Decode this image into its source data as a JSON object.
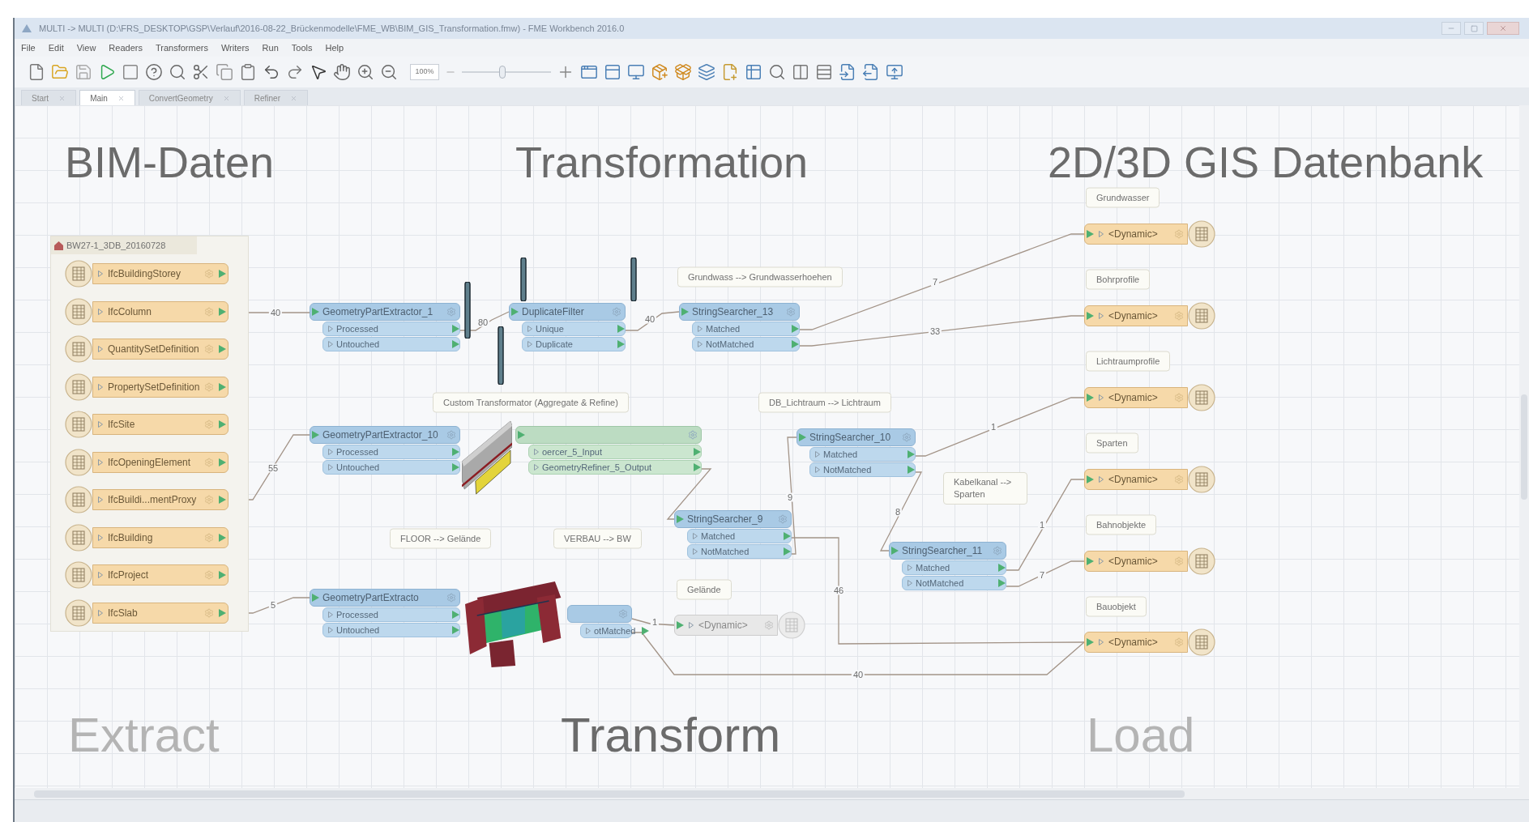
{
  "window": {
    "title": "MULTI -> MULTI (D:\\FRS_DESKTOP\\GSP\\Verlauf\\2016-08-22_Brückenmodelle\\FME_WB\\BIM_GIS_Transformation.fmw) - FME Workbench 2016.0"
  },
  "menu": [
    "File",
    "Edit",
    "View",
    "Readers",
    "Transformers",
    "Writers",
    "Run",
    "Tools",
    "Help"
  ],
  "toolbar": {
    "zoom": "100%",
    "zoom_slider": {
      "level": 0.45
    }
  },
  "tabs": [
    {
      "label": "Start",
      "selected": false
    },
    {
      "label": "Main",
      "selected": true
    },
    {
      "label": "ConvertGeometry",
      "selected": false
    },
    {
      "label": "Refiner",
      "selected": false
    }
  ],
  "canvas": {
    "headings": [
      {
        "text": "BIM-Daten",
        "kind": "strong"
      },
      {
        "text": "Transformation",
        "kind": "strong"
      },
      {
        "text": "2D/3D GIS Datenbank",
        "kind": "strong"
      }
    ],
    "phases": [
      {
        "text": "Extract",
        "kind": "faded"
      },
      {
        "text": "Transform",
        "kind": "strong"
      },
      {
        "text": "Load",
        "kind": "faded"
      }
    ],
    "reader": {
      "name": "BW27-1_3DB_20160728",
      "feature_types": [
        "IfcBuildingStorey",
        "IfcColumn",
        "QuantitySetDefinition",
        "PropertySetDefinition",
        "IfcSite",
        "IfcOpeningElement",
        "IfcBuildi...mentProxy",
        "IfcBuilding",
        "IfcProject",
        "IfcSlab"
      ]
    },
    "transformers": [
      {
        "kind": "standard",
        "name": "GeometryPartExtractor_1",
        "ports": [
          "Processed",
          "Untouched"
        ]
      },
      {
        "kind": "standard",
        "name": "DuplicateFilter",
        "ports": [
          "Unique",
          "Duplicate"
        ]
      },
      {
        "kind": "standard",
        "name": "StringSearcher_13",
        "ports": [
          "Matched",
          "NotMatched"
        ]
      },
      {
        "kind": "standard",
        "name": "GeometryPartExtractor_10",
        "ports": [
          "Processed",
          "Untouched"
        ]
      },
      {
        "kind": "custom",
        "ports": [
          "oercer_5_Input",
          "GeometryRefiner_5_Output"
        ]
      },
      {
        "kind": "standard",
        "name": "StringSearcher_10",
        "ports": [
          "Matched",
          "NotMatched"
        ]
      },
      {
        "kind": "standard",
        "name": "StringSearcher_9",
        "ports": [
          "Matched",
          "NotMatched"
        ]
      },
      {
        "kind": "standard",
        "name": "GeometryPartExtracto",
        "ports": [
          "Processed",
          "Untouched"
        ]
      },
      {
        "kind": "standard",
        "ports": [
          "otMatched"
        ]
      },
      {
        "kind": "standard",
        "name": "StringSearcher_11",
        "ports": [
          "Matched",
          "NotMatched"
        ]
      }
    ],
    "annotations": [
      "Grundwass --> Grundwasserhoehen",
      "Custom Transformator (Aggregate & Refine)",
      "DB_Lichtraum --> Lichtraum",
      "FLOOR --> Gelände",
      "VERBAU --> BW",
      "Gelände",
      "Kabelkanal --> Sparten",
      "Grundwasser",
      "Bohrprofile",
      "Lichtraumprofile",
      "Sparten",
      "Bahnobjekte",
      "Bauobjekt"
    ],
    "writers": [
      {
        "name": "<Dynamic>",
        "disabled": false
      },
      {
        "name": "<Dynamic>",
        "disabled": false
      },
      {
        "name": "<Dynamic>",
        "disabled": false
      },
      {
        "name": "<Dynamic>",
        "disabled": false
      },
      {
        "name": "<Dynamic>",
        "disabled": false
      },
      {
        "name": "<Dynamic>",
        "disabled": false
      },
      {
        "name": "<Dynamic>",
        "disabled": true
      }
    ],
    "connections": [
      {
        "label": "40"
      },
      {
        "label": "80"
      },
      {
        "label": "40"
      },
      {
        "label": "7"
      },
      {
        "label": "33"
      },
      {
        "label": "55"
      },
      {
        "label": "5"
      },
      {
        "label": "9"
      },
      {
        "label": "1"
      },
      {
        "label": "8"
      },
      {
        "label": "1"
      },
      {
        "label": "7"
      },
      {
        "label": "46"
      },
      {
        "label": "1"
      },
      {
        "label": "40"
      }
    ]
  }
}
